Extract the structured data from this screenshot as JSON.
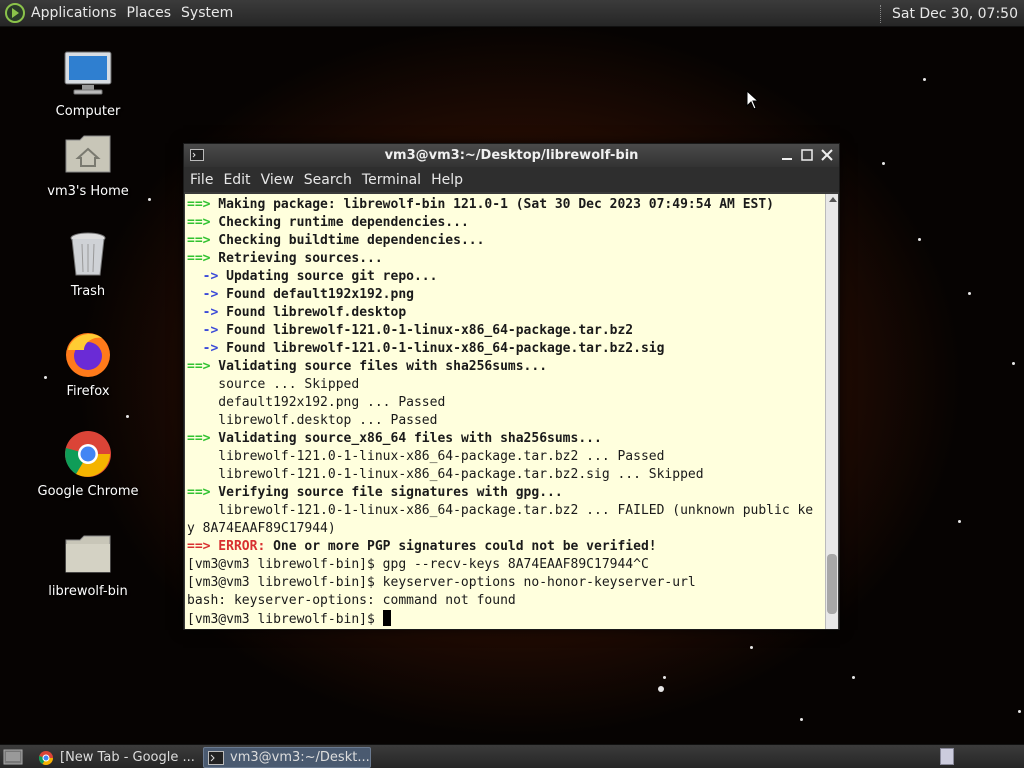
{
  "top_panel": {
    "menus": [
      "Applications",
      "Places",
      "System"
    ],
    "clock": "Sat Dec 30, 07:50"
  },
  "desktop_icons": [
    {
      "label": "Computer",
      "icon": "computer-icon"
    },
    {
      "label": "vm3's Home",
      "icon": "home-folder-icon"
    },
    {
      "label": "Trash",
      "icon": "trash-icon"
    },
    {
      "label": "Firefox",
      "icon": "firefox-icon"
    },
    {
      "label": "Google Chrome",
      "icon": "chrome-icon"
    },
    {
      "label": "librewolf-bin",
      "icon": "folder-icon"
    }
  ],
  "terminal": {
    "title": "vm3@vm3:~/Desktop/librewolf-bin",
    "menu": [
      "File",
      "Edit",
      "View",
      "Search",
      "Terminal",
      "Help"
    ],
    "lines": [
      {
        "prefix": "==>",
        "pc": "g",
        "text": " Making package: librewolf-bin 121.0-1 (Sat 30 Dec 2023 07:49:54 AM EST)",
        "bold": true
      },
      {
        "prefix": "==>",
        "pc": "g",
        "text": " Checking runtime dependencies...",
        "bold": true
      },
      {
        "prefix": "==>",
        "pc": "g",
        "text": " Checking buildtime dependencies...",
        "bold": true
      },
      {
        "prefix": "==>",
        "pc": "g",
        "text": " Retrieving sources...",
        "bold": true
      },
      {
        "prefix": "  ->",
        "pc": "b",
        "text": " Updating source git repo...",
        "bold": true
      },
      {
        "prefix": "  ->",
        "pc": "b",
        "text": " Found default192x192.png",
        "bold": true
      },
      {
        "prefix": "  ->",
        "pc": "b",
        "text": " Found librewolf.desktop",
        "bold": true
      },
      {
        "prefix": "  ->",
        "pc": "b",
        "text": " Found librewolf-121.0-1-linux-x86_64-package.tar.bz2",
        "bold": true
      },
      {
        "prefix": "  ->",
        "pc": "b",
        "text": " Found librewolf-121.0-1-linux-x86_64-package.tar.bz2.sig",
        "bold": true
      },
      {
        "prefix": "==>",
        "pc": "g",
        "text": " Validating source files with sha256sums...",
        "bold": true
      },
      {
        "prefix": "",
        "pc": "",
        "text": "    source ... Skipped",
        "bold": false
      },
      {
        "prefix": "",
        "pc": "",
        "text": "    default192x192.png ... Passed",
        "bold": false
      },
      {
        "prefix": "",
        "pc": "",
        "text": "    librewolf.desktop ... Passed",
        "bold": false
      },
      {
        "prefix": "==>",
        "pc": "g",
        "text": " Validating source_x86_64 files with sha256sums...",
        "bold": true
      },
      {
        "prefix": "",
        "pc": "",
        "text": "    librewolf-121.0-1-linux-x86_64-package.tar.bz2 ... Passed",
        "bold": false
      },
      {
        "prefix": "",
        "pc": "",
        "text": "    librewolf-121.0-1-linux-x86_64-package.tar.bz2.sig ... Skipped",
        "bold": false
      },
      {
        "prefix": "==>",
        "pc": "g",
        "text": " Verifying source file signatures with gpg...",
        "bold": true
      },
      {
        "prefix": "",
        "pc": "",
        "text": "    librewolf-121.0-1-linux-x86_64-package.tar.bz2 ... FAILED (unknown public ke",
        "bold": false
      },
      {
        "prefix": "",
        "pc": "",
        "text": "y 8A74EAAF89C17944)",
        "bold": false
      },
      {
        "prefix": "==>",
        "pc": "r",
        "text": " One or more PGP signatures could not be verified!",
        "bold": true,
        "error_label": "ERROR:"
      },
      {
        "prefix": "",
        "pc": "",
        "text": "[vm3@vm3 librewolf-bin]$ gpg --recv-keys 8A74EAAF89C17944^C",
        "bold": false
      },
      {
        "prefix": "",
        "pc": "",
        "text": "[vm3@vm3 librewolf-bin]$ keyserver-options no-honor-keyserver-url",
        "bold": false
      },
      {
        "prefix": "",
        "pc": "",
        "text": "bash: keyserver-options: command not found",
        "bold": false
      }
    ],
    "prompt": "[vm3@vm3 librewolf-bin]$ "
  },
  "taskbar": {
    "tasks": [
      {
        "label": "[New Tab - Google ...",
        "icon": "chrome-icon",
        "active": false
      },
      {
        "label": "vm3@vm3:~/Deskt...",
        "icon": "terminal-icon",
        "active": true
      }
    ]
  },
  "colors": {
    "terminal_bg": "#ffffdd",
    "prefix_green": "#30c230",
    "arrow_blue": "#3b4ad8",
    "error_red": "#d83030"
  }
}
